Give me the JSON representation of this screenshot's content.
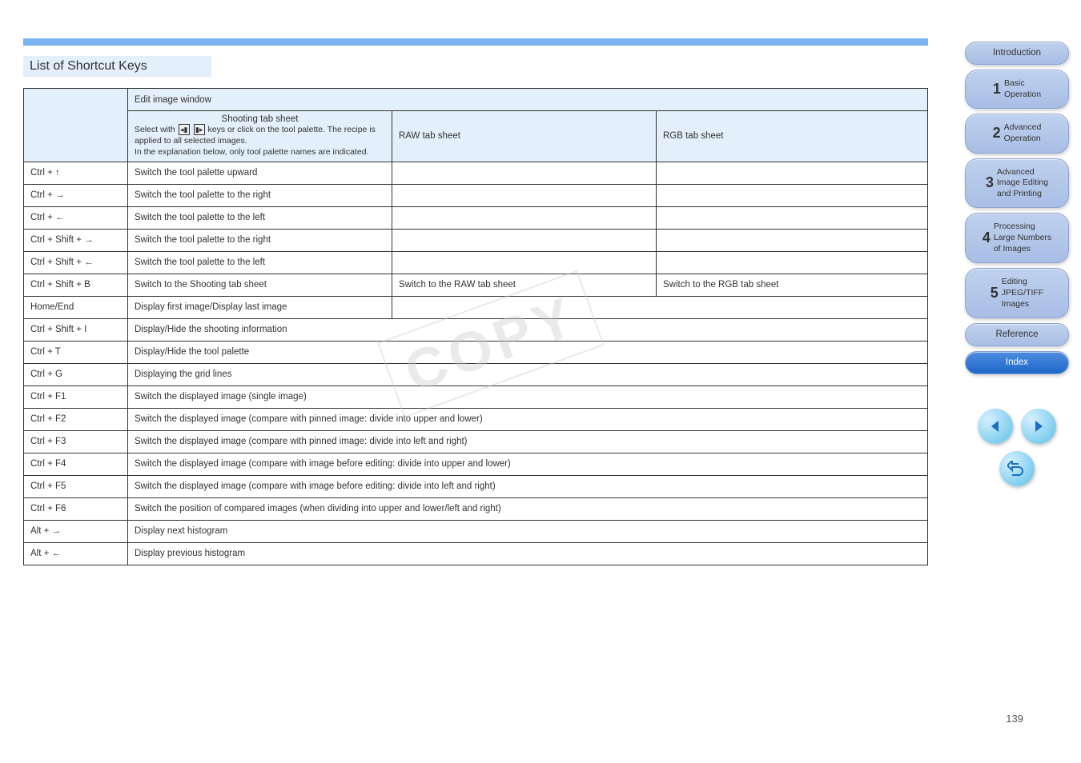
{
  "section_title": "List of Shortcut Keys",
  "watermark": "COPY",
  "table": {
    "top_span": "Edit image window",
    "headers": {
      "left_blank": "",
      "col_a_line1": "Shooting tab sheet",
      "col_a_note_prefix": "Select with",
      "col_a_note_body": "keys or click on the tool palette. The recipe is applied to all selected images.",
      "col_a_note_suffix": "In the explanation below, only tool palette names are indicated.",
      "col_b": "RAW tab sheet",
      "col_c": "RGB tab sheet"
    },
    "rows_top": [
      {
        "key": "Ctrl + ↑",
        "c1": "Switch the tool palette upward",
        "c2": "",
        "c3": ""
      },
      {
        "key": "Ctrl + →",
        "c1": "Switch the tool palette to the right",
        "c2": "",
        "c3": ""
      },
      {
        "key": "Ctrl + ←",
        "c1": "Switch the tool palette to the left",
        "c2": "",
        "c3": ""
      },
      {
        "key": "Ctrl + Shift + →",
        "c1": "Switch the tool palette to the right",
        "c2": "",
        "c3": ""
      },
      {
        "key": "Ctrl + Shift + ←",
        "c1": "Switch the tool palette to the left",
        "c2": "",
        "c3": ""
      },
      {
        "key": "Ctrl + Shift + B",
        "c1": "Switch to the Shooting tab sheet",
        "c2": "Switch to the RAW tab sheet",
        "c3": "Switch to the RGB tab sheet"
      }
    ],
    "row_first_last": {
      "key": "Home/End",
      "c1": "Display first image/Display last image",
      "c23": ""
    },
    "rows_full": [
      {
        "key": "Ctrl + Shift + I",
        "val": "Display/Hide the shooting information"
      },
      {
        "key": "Ctrl + T",
        "val": "Display/Hide the tool palette"
      },
      {
        "key": "Ctrl + G",
        "val": "Displaying the grid lines"
      },
      {
        "key": "Ctrl + F1",
        "val": "Switch the displayed image (single image)"
      },
      {
        "key": "Ctrl + F2",
        "val": "Switch the displayed image (compare with pinned image: divide into upper and lower)"
      },
      {
        "key": "Ctrl + F3",
        "val": "Switch the displayed image (compare with pinned image: divide into left and right)"
      },
      {
        "key": "Ctrl + F4",
        "val": "Switch the displayed image (compare with image before editing: divide into upper and lower)"
      },
      {
        "key": "Ctrl + F5",
        "val": "Switch the displayed image (compare with image before editing: divide into left and right)"
      },
      {
        "key": "Ctrl + F6",
        "val": "Switch the position of compared images (when dividing into upper and lower/left and right)"
      },
      {
        "key": "Alt + →",
        "val": "Display next histogram"
      },
      {
        "key": "Alt + ←",
        "val": "Display previous histogram"
      }
    ]
  },
  "nav": [
    {
      "label": "Introduction"
    },
    {
      "chapter": "1",
      "label": "Basic\nOperation"
    },
    {
      "chapter": "2",
      "label": "Advanced\nOperation"
    },
    {
      "chapter": "3",
      "label": "Advanced\nImage Editing\nand Printing"
    },
    {
      "chapter": "4",
      "label": "Processing\nLarge Numbers\nof Images"
    },
    {
      "chapter": "5",
      "label": "Editing\nJPEG/TIFF\nImages"
    },
    {
      "label": "Reference"
    },
    {
      "label": "Index"
    }
  ],
  "page_number": "139",
  "active_nav_index": 7
}
